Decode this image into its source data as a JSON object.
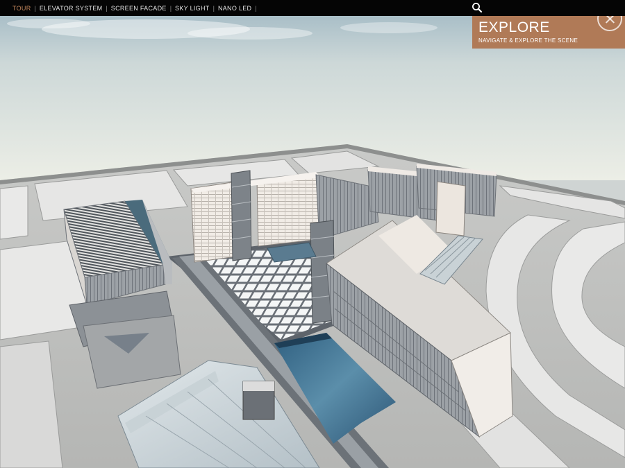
{
  "topbar": {
    "nav": [
      {
        "label": "TOUR",
        "active": true
      },
      {
        "label": "ELEVATOR SYSTEM",
        "active": false
      },
      {
        "label": "SCREEN FACADE",
        "active": false
      },
      {
        "label": "SKY LIGHT",
        "active": false
      },
      {
        "label": "NANO LED",
        "active": false
      }
    ],
    "separator": "|",
    "search_icon": "search-icon"
  },
  "explore_panel": {
    "title": "EXPLORE",
    "subtitle": "NAVIGATE & EXPLORE THE SCENE",
    "close_icon": "close-icon"
  },
  "colors": {
    "topbar_bg": "#050505",
    "nav_text": "#e6e6e6",
    "nav_active": "#c98a5e",
    "panel_bg": "#b07a57",
    "sky_top": "#a9c0cb",
    "sky_bottom": "#e8eae4",
    "water": "#3e6d8c"
  }
}
